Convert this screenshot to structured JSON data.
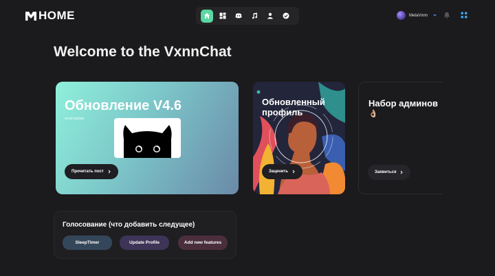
{
  "app": {
    "logo_text": "HOME",
    "page_title": "Welcome to the VxnnChat"
  },
  "nav": {
    "items": [
      {
        "icon": "home-icon",
        "active": true
      },
      {
        "icon": "dashboard-icon",
        "active": false
      },
      {
        "icon": "discord-icon",
        "active": false
      },
      {
        "icon": "music-note-icon",
        "active": false
      },
      {
        "icon": "user-icon",
        "active": false
      },
      {
        "icon": "check-badge-icon",
        "active": false
      }
    ]
  },
  "profile": {
    "name": "MetaVxnn"
  },
  "cards": {
    "main": {
      "title": "Обновление V4.6",
      "subtitle": "small update",
      "button_label": "Прочитать пост"
    },
    "profile_update": {
      "title": "Обновленный профиль",
      "button_label": "Заценить"
    },
    "admins": {
      "title": "Набор админов",
      "emoji": "👌🏼",
      "button_label": "Заявиться"
    }
  },
  "poll": {
    "title": "Голосование (что добавить следущее)",
    "options": [
      "SleepTimer",
      "Update Profile",
      "Add new features"
    ]
  },
  "colors": {
    "background": "#1b1a1c",
    "accent": "#5ad7a3",
    "card_gradient_start": "#8ff0da",
    "card_gradient_end": "#6a8aa8"
  }
}
